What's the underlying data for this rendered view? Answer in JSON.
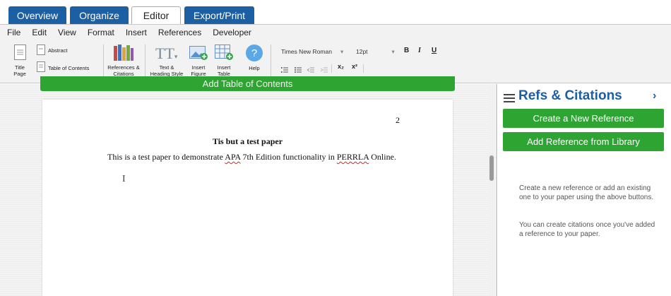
{
  "tabs": [
    {
      "label": "Overview",
      "active": false
    },
    {
      "label": "Organize",
      "active": false
    },
    {
      "label": "Editor",
      "active": true
    },
    {
      "label": "Export/Print",
      "active": false
    }
  ],
  "menu": [
    "File",
    "Edit",
    "View",
    "Format",
    "Insert",
    "References",
    "Developer"
  ],
  "toolbar": {
    "title_page": "Title Page",
    "abstract": "Abstract",
    "toc": "Table of Contents",
    "refs_citations": "References & Citations",
    "text_heading": "Text & Heading Style",
    "insert_figure": "Insert Figure",
    "insert_table": "Insert Table",
    "help": "Help",
    "font_family": "Times New Roman",
    "font_size": "12pt",
    "bold": "B",
    "italic": "I",
    "underline": "U",
    "subscript": "x₂",
    "superscript": "x²"
  },
  "editor": {
    "add_toc": "Add Table of Contents",
    "page_number": "2",
    "paper_title": "Tis but a test paper",
    "body_before": "This is a test paper to demonstrate ",
    "body_apa": "APA",
    "body_mid": " 7th Edition functionality in ",
    "body_perrla": "PERRLA",
    "body_after": " Online.",
    "cursor": "I"
  },
  "panel": {
    "title": "Refs & Citations",
    "create_ref": "Create a New Reference",
    "add_from_library": "Add Reference from Library",
    "info1": "Create a new reference or add an existing one to your paper using the above buttons.",
    "info2": "You can create citations once you've added a reference to your paper."
  },
  "colors": {
    "brand_blue": "#1d5fa3",
    "green": "#2ea533"
  }
}
